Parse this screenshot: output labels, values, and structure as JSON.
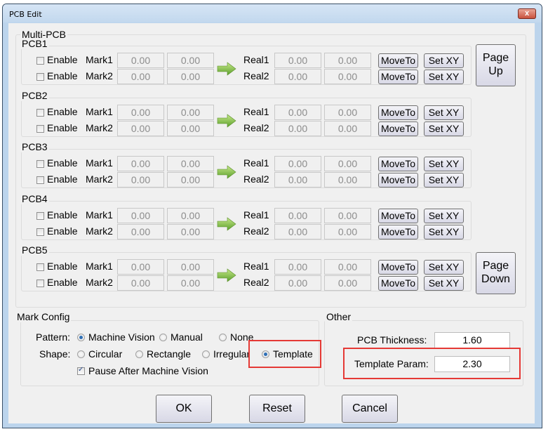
{
  "window": {
    "title": "PCB Edit",
    "close_label": "x"
  },
  "multi_pcb": {
    "label": "Multi-PCB",
    "enable_label": "Enable",
    "mark_labels": [
      "Mark1",
      "Mark2"
    ],
    "real_labels": [
      "Real1",
      "Real2"
    ],
    "moveto_label": "MoveTo",
    "setxy_label": "Set XY",
    "pcbs": [
      {
        "name": "PCB1",
        "rows": [
          {
            "enabled": false,
            "mark": [
              "0.00",
              "0.00"
            ],
            "real": [
              "0.00",
              "0.00"
            ]
          },
          {
            "enabled": false,
            "mark": [
              "0.00",
              "0.00"
            ],
            "real": [
              "0.00",
              "0.00"
            ]
          }
        ]
      },
      {
        "name": "PCB2",
        "rows": [
          {
            "enabled": false,
            "mark": [
              "0.00",
              "0.00"
            ],
            "real": [
              "0.00",
              "0.00"
            ]
          },
          {
            "enabled": false,
            "mark": [
              "0.00",
              "0.00"
            ],
            "real": [
              "0.00",
              "0.00"
            ]
          }
        ]
      },
      {
        "name": "PCB3",
        "rows": [
          {
            "enabled": false,
            "mark": [
              "0.00",
              "0.00"
            ],
            "real": [
              "0.00",
              "0.00"
            ]
          },
          {
            "enabled": false,
            "mark": [
              "0.00",
              "0.00"
            ],
            "real": [
              "0.00",
              "0.00"
            ]
          }
        ]
      },
      {
        "name": "PCB4",
        "rows": [
          {
            "enabled": false,
            "mark": [
              "0.00",
              "0.00"
            ],
            "real": [
              "0.00",
              "0.00"
            ]
          },
          {
            "enabled": false,
            "mark": [
              "0.00",
              "0.00"
            ],
            "real": [
              "0.00",
              "0.00"
            ]
          }
        ]
      },
      {
        "name": "PCB5",
        "rows": [
          {
            "enabled": false,
            "mark": [
              "0.00",
              "0.00"
            ],
            "real": [
              "0.00",
              "0.00"
            ]
          },
          {
            "enabled": false,
            "mark": [
              "0.00",
              "0.00"
            ],
            "real": [
              "0.00",
              "0.00"
            ]
          }
        ]
      }
    ],
    "page_up": [
      "Page",
      "Up"
    ],
    "page_down": [
      "Page",
      "Down"
    ]
  },
  "mark_config": {
    "label": "Mark Config",
    "pattern_label": "Pattern:",
    "pattern_options": [
      "Machine Vision",
      "Manual",
      "None"
    ],
    "pattern_selected": "Machine Vision",
    "shape_label": "Shape:",
    "shape_options": [
      "Circular",
      "Rectangle",
      "Irregular",
      "Template"
    ],
    "shape_selected": "Template",
    "pause_label": "Pause After Machine Vision",
    "pause_checked": true
  },
  "other": {
    "label": "Other",
    "thickness_label": "PCB Thickness:",
    "thickness_value": "1.60",
    "template_label": "Template Param:",
    "template_value": "2.30"
  },
  "buttons": {
    "ok": "OK",
    "reset": "Reset",
    "cancel": "Cancel"
  },
  "colors": {
    "highlight": "#e53935",
    "radio_selected": "#2f6fb5",
    "arrow": "#7cc242"
  }
}
